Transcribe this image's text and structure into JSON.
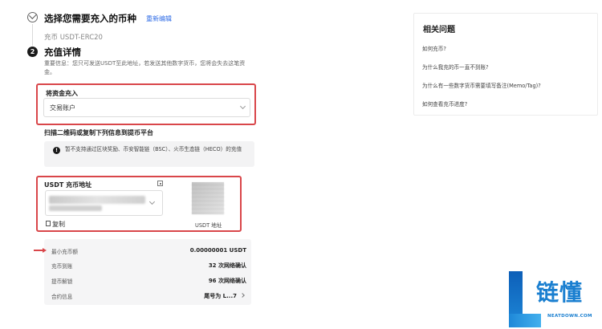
{
  "step1": {
    "number": "1",
    "title": "选择您需要充入的币种",
    "edit_label": "重新编辑",
    "subtitle": "充币 USDT-ERC20"
  },
  "step2": {
    "number": "2",
    "title": "充值详情",
    "notice": "重要信息：您只可发送USDT至此地址，若发送其他数字货币，您将会失去这笔资金。"
  },
  "fund": {
    "label": "将资金充入",
    "selected": "交易账户"
  },
  "scan_title": "扫描二维码或复制下列信息到提币平台",
  "warning": {
    "icon": "info-icon",
    "text": "暂不支持通过区块奖励、币安智能链（BSC）、火币生态链（HECO）的充值"
  },
  "address": {
    "label": "USDT 充币地址",
    "copy_label": "复制",
    "qr_caption": "USDT 地址"
  },
  "info_rows": [
    {
      "key": "最小充币额",
      "value": "0.00000001 USDT"
    },
    {
      "key": "充币到账",
      "value": "32 次网络确认"
    },
    {
      "key": "提币解锁",
      "value": "96 次网络确认"
    },
    {
      "key": "合约信息",
      "value": "尾号为 L...7"
    }
  ],
  "faq": {
    "title": "相关问题",
    "items": [
      "如何充币?",
      "为什么我充的币一直不到账?",
      "为什么有一些数字货币需要填写备注(Memo/Tag)?",
      "如何查看充币进度?"
    ]
  },
  "logo": {
    "text": "链懂",
    "sub": "NEATDOWN.COM"
  },
  "colors": {
    "accent": "#2e6be6",
    "highlight": "#d9464a",
    "logo": "#1a7fd0"
  }
}
